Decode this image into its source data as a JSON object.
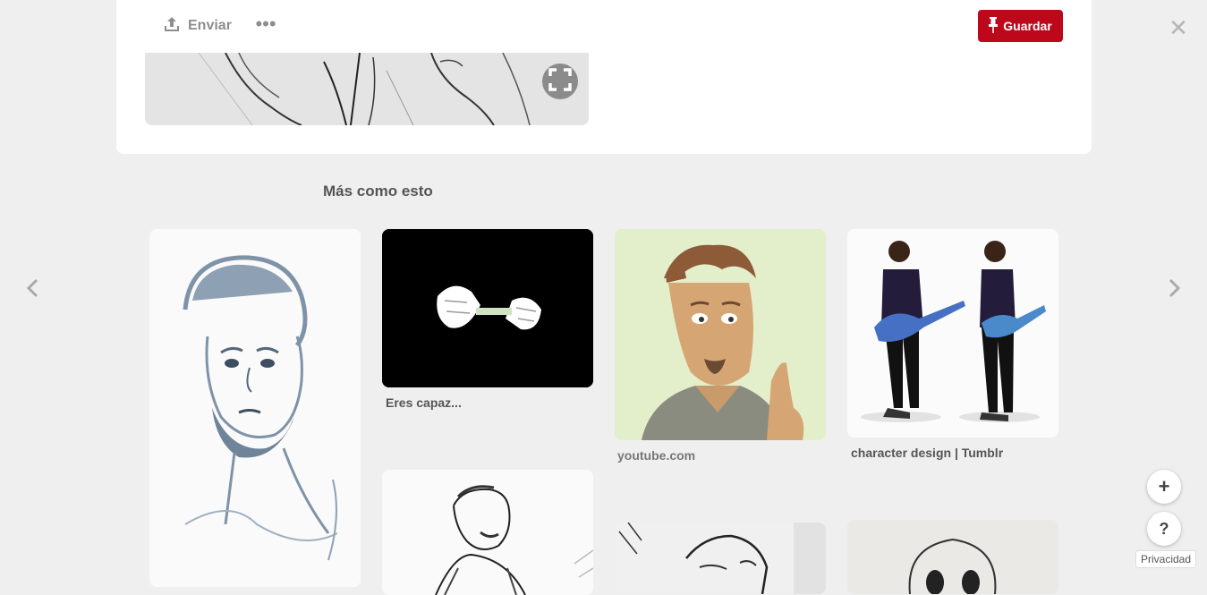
{
  "toolbar": {
    "share_label": "Enviar",
    "more_label": "•••",
    "save_label": "Guardar",
    "close_label": "✕",
    "save_color": "#bd081c"
  },
  "section": {
    "title": "Más como esto"
  },
  "grid": {
    "tiles": [
      {
        "caption": ""
      },
      {
        "caption": "Eres capaz..."
      },
      {
        "caption": "youtube.com"
      },
      {
        "caption": "character design | Tumblr"
      },
      {
        "caption": ""
      },
      {
        "caption": ""
      },
      {
        "caption": ""
      }
    ]
  },
  "floating": {
    "add_label": "+",
    "help_label": "?",
    "privacy_label": "Privacidad"
  },
  "icons": [
    "share-icon",
    "pin-icon",
    "expand-icon",
    "chevron-left-icon",
    "chevron-right-icon"
  ]
}
